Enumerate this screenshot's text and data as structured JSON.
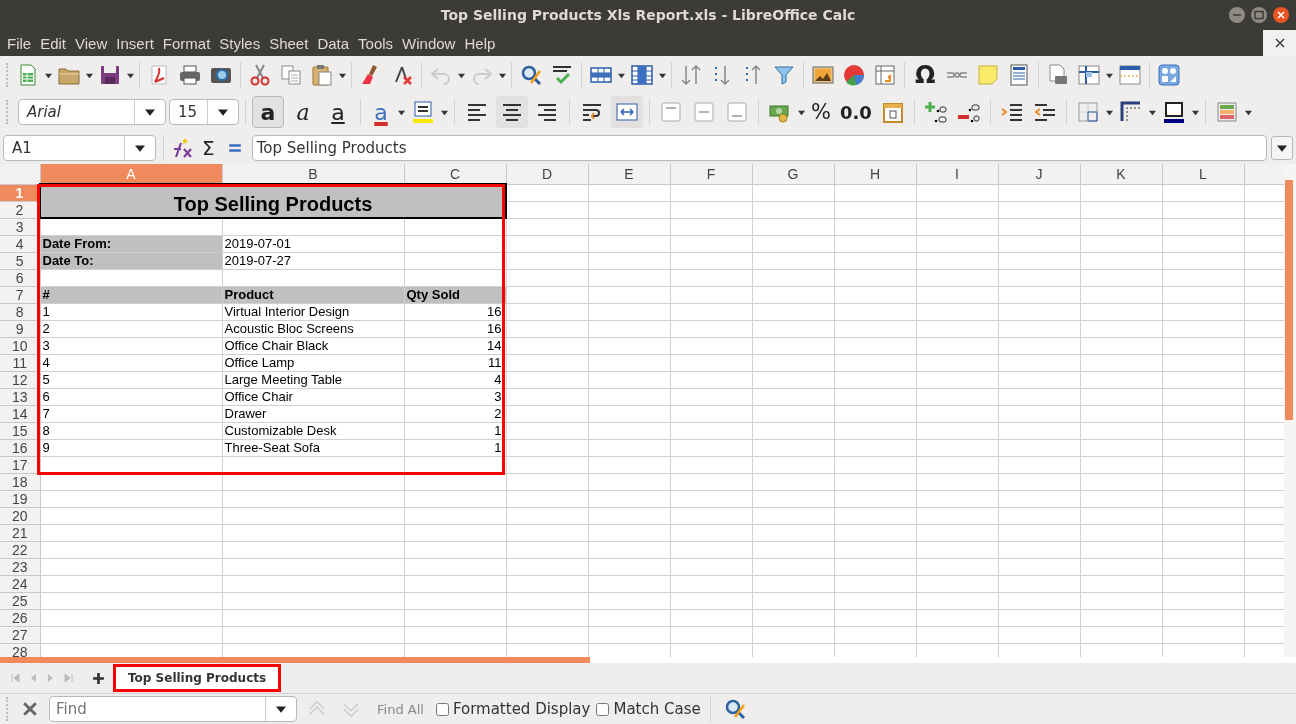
{
  "window": {
    "title": "Top Selling Products Xls Report.xls - LibreOffice Calc"
  },
  "menu": [
    "File",
    "Edit",
    "View",
    "Insert",
    "Format",
    "Styles",
    "Sheet",
    "Data",
    "Tools",
    "Window",
    "Help"
  ],
  "toolbar": {
    "special_character": "Ω",
    "font_name": "Arial",
    "font_size": "15",
    "format_buttons": [
      {
        "kind": "bold",
        "glyph": "a",
        "selected": true
      },
      {
        "kind": "italic",
        "glyph": "a",
        "selected": false
      },
      {
        "kind": "underline",
        "glyph": "a",
        "selected": false
      }
    ],
    "font_color_glyph": "a",
    "alignment": [
      {
        "kind": "left",
        "selected": false
      },
      {
        "kind": "center",
        "selected": true
      },
      {
        "kind": "right",
        "selected": false
      }
    ],
    "merge_cells": true,
    "percent": "%",
    "number_format": "0.0"
  },
  "formula_bar": {
    "name_box": "A1",
    "sum": "Σ",
    "formula": "Top Selling Products"
  },
  "columns": [
    {
      "label": "A",
      "selected": true
    },
    {
      "label": "B",
      "selected": false
    },
    {
      "label": "C",
      "selected": false
    },
    {
      "label": "D",
      "selected": false
    },
    {
      "label": "E",
      "selected": false
    },
    {
      "label": "F",
      "selected": false
    },
    {
      "label": "G",
      "selected": false
    },
    {
      "label": "H",
      "selected": false
    },
    {
      "label": "I",
      "selected": false
    },
    {
      "label": "J",
      "selected": false
    },
    {
      "label": "K",
      "selected": false
    },
    {
      "label": "L",
      "selected": false
    }
  ],
  "rows": [
    {
      "label": "1",
      "selected": true
    },
    {
      "label": "2",
      "selected": false
    },
    {
      "label": "3",
      "selected": false
    },
    {
      "label": "4",
      "selected": false
    },
    {
      "label": "5",
      "selected": false
    },
    {
      "label": "6",
      "selected": false
    },
    {
      "label": "7",
      "selected": false
    },
    {
      "label": "8",
      "selected": false
    },
    {
      "label": "9",
      "selected": false
    },
    {
      "label": "10",
      "selected": false
    },
    {
      "label": "11",
      "selected": false
    },
    {
      "label": "12",
      "selected": false
    },
    {
      "label": "13",
      "selected": false
    },
    {
      "label": "14",
      "selected": false
    },
    {
      "label": "15",
      "selected": false
    },
    {
      "label": "16",
      "selected": false
    },
    {
      "label": "17",
      "selected": false
    },
    {
      "label": "18",
      "selected": false
    },
    {
      "label": "19",
      "selected": false
    },
    {
      "label": "20",
      "selected": false
    },
    {
      "label": "21",
      "selected": false
    },
    {
      "label": "22",
      "selected": false
    },
    {
      "label": "23",
      "selected": false
    },
    {
      "label": "24",
      "selected": false
    },
    {
      "label": "25",
      "selected": false
    },
    {
      "label": "26",
      "selected": false
    },
    {
      "label": "27",
      "selected": false
    },
    {
      "label": "28",
      "selected": false
    }
  ],
  "report": {
    "title": "Top Selling Products",
    "highlighted": true,
    "fields": [
      {
        "label": "Date From:",
        "value": "2019-07-01"
      },
      {
        "label": "Date To:",
        "value": "2019-07-27"
      }
    ],
    "columns": [
      "#",
      "Product",
      "Qty Sold"
    ],
    "items": [
      {
        "rank": "1",
        "product": "Virtual Interior Design",
        "qty": "16"
      },
      {
        "rank": "2",
        "product": "Acoustic Bloc Screens",
        "qty": "16"
      },
      {
        "rank": "3",
        "product": "Office Chair Black",
        "qty": "14"
      },
      {
        "rank": "4",
        "product": "Office Lamp",
        "qty": "11"
      },
      {
        "rank": "5",
        "product": "Large Meeting Table",
        "qty": "4"
      },
      {
        "rank": "6",
        "product": "Office Chair",
        "qty": "3"
      },
      {
        "rank": "7",
        "product": "Drawer",
        "qty": "2"
      },
      {
        "rank": "8",
        "product": "Customizable Desk",
        "qty": "1"
      },
      {
        "rank": "9",
        "product": "Three-Seat Sofa",
        "qty": "1"
      }
    ]
  },
  "sheet_tabs": [
    {
      "label": "Top Selling Products",
      "selected": true,
      "highlighted": true
    }
  ],
  "find_bar": {
    "placeholder": "Find",
    "find_all": "Find All",
    "options": [
      {
        "label": "Formatted Display",
        "checked": false
      },
      {
        "label": "Match Case",
        "checked": false
      }
    ]
  }
}
